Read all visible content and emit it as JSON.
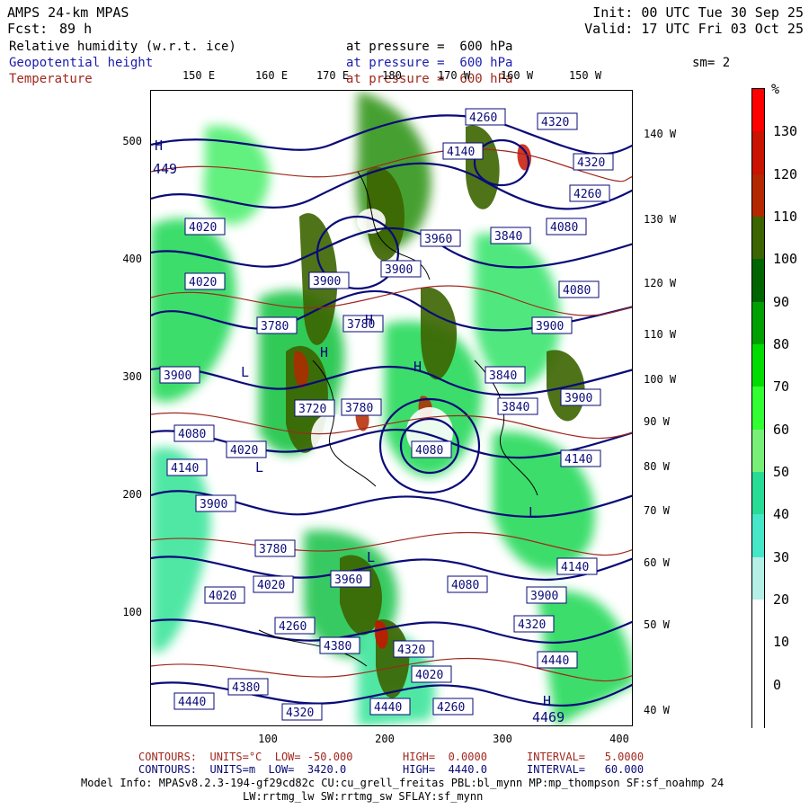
{
  "header": {
    "model": "AMPS 24-km MPAS",
    "init": "Init: 00 UTC Tue 30 Sep 25",
    "fcst_label": "Fcst:",
    "fcst_value": "89 h",
    "valid": "Valid: 17 UTC Fri 03 Oct 25",
    "fields": [
      {
        "name": "Relative humidity (w.r.t. ice)",
        "level": "at pressure =  600 hPa",
        "color": "#000000"
      },
      {
        "name": "Geopotential height",
        "level": "at pressure =  600 hPa",
        "color": "#1c1cb0"
      },
      {
        "name": "Temperature",
        "level": "at pressure =  600 hPa",
        "color": "#a0281e"
      }
    ],
    "smoothing": "sm= 2"
  },
  "axes": {
    "x_ticks": [
      "100",
      "200",
      "300",
      "400"
    ],
    "y_ticks": [
      "100",
      "200",
      "300",
      "400",
      "500"
    ],
    "top_lon_labels": [
      "150 E",
      "160 E",
      "170 E",
      "180",
      "170 W",
      "160 W",
      "150 W"
    ],
    "right_lon_labels": [
      "140 W",
      "130 W",
      "120 W",
      "110 W",
      "100 W",
      "90 W",
      "80 W",
      "70 W",
      "60 W",
      "50 W",
      "40 W"
    ]
  },
  "map_labels": {
    "height_boxes": [
      "4260",
      "4320",
      "4140",
      "4320",
      "4260",
      "4020",
      "3960",
      "3840",
      "4080",
      "4020",
      "3900",
      "3900",
      "4080",
      "3900",
      "3780",
      "3780",
      "3840",
      "3900",
      "3780",
      "3720",
      "3840",
      "3900",
      "4080",
      "4140",
      "4080",
      "4020",
      "4140",
      "3900",
      "3780",
      "3960",
      "4020",
      "4140",
      "4020",
      "4080",
      "3900",
      "4260",
      "4320",
      "4380",
      "4440",
      "4440",
      "4320",
      "4260",
      "4380",
      "4440",
      "4020",
      "4320"
    ],
    "highs": [
      "H",
      "H",
      "H",
      "H",
      "H"
    ],
    "lows": [
      "L",
      "L",
      "L",
      "L"
    ],
    "high_values": [
      "449",
      "4469"
    ]
  },
  "colorbar": {
    "unit": "%",
    "labels": [
      "130",
      "120",
      "110",
      "100",
      "90",
      "80",
      "70",
      "60",
      "50",
      "40",
      "30",
      "20",
      "10",
      "0"
    ],
    "colors": [
      "#ff0000",
      "#c81400",
      "#b42800",
      "#3c6400",
      "#006400",
      "#00a000",
      "#00dc00",
      "#32ff32",
      "#78f078",
      "#28dc96",
      "#46e6c8",
      "#b4f0e6",
      "#ffffff",
      "#ffffff",
      "#ffffff"
    ]
  },
  "footer": {
    "line1_left": "CONTOURS:  UNITS=°C  LOW= -50.000",
    "line1_mid": "HIGH=  0.0000",
    "line1_right": "INTERVAL=   5.0000",
    "line2_left": "CONTOURS:  UNITS=m  LOW=  3420.0",
    "line2_mid": "HIGH=  4440.0",
    "line2_right": "INTERVAL=   60.000",
    "model_info": "Model Info: MPASv8.2.3-194-gf29cd82c CU:cu_grell_freitas PBL:bl_mynn MP:mp_thompson SF:sf_noahmp 24",
    "model_info2": "LW:rrtmg_lw SW:rrtmg_sw SFLAY:sf_mynn",
    "line1_color": "#a0281e",
    "line2_color": "#0a0a78"
  }
}
